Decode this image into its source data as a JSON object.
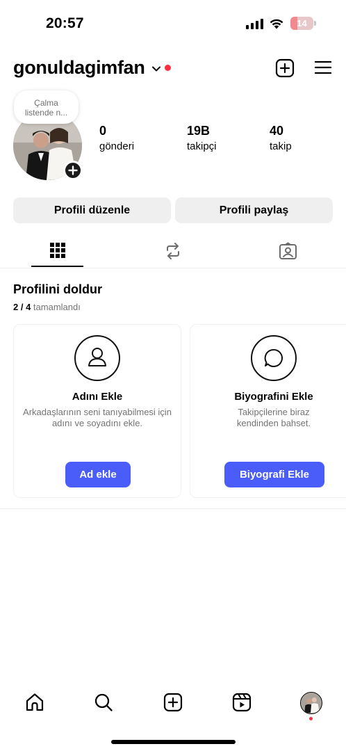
{
  "status_bar": {
    "time": "20:57",
    "battery": "14",
    "battery_level": 0.14,
    "icons": [
      "cellular-signal-icon",
      "wifi-icon",
      "battery-charging-icon"
    ]
  },
  "header": {
    "username": "gonuldagimfan",
    "icons": [
      "chevron-down-icon",
      "notification-dot",
      "create-post-icon",
      "menu-icon"
    ],
    "accent_red": "#ff2f40"
  },
  "profile": {
    "note_line1": "Çalma",
    "note_line2": "listende n...",
    "stats": [
      {
        "value": "0",
        "label": "gönderi"
      },
      {
        "value": "19B",
        "label": "takipçi"
      },
      {
        "value": "40",
        "label": "takip"
      }
    ]
  },
  "actions": {
    "edit_label": "Profili düzenle",
    "share_label": "Profili paylaş"
  },
  "tabs": [
    {
      "icon": "grid-icon",
      "active": true
    },
    {
      "icon": "reposts-icon",
      "active": false
    },
    {
      "icon": "tagged-icon",
      "active": false
    }
  ],
  "complete_profile": {
    "title": "Profilini doldur",
    "progress_done": "2 / 4",
    "progress_text": "tamamlandı",
    "cards": [
      {
        "icon": "person-icon",
        "title": "Adını Ekle",
        "description": "Arkadaşlarının seni tanıyabilmesi için adını ve soyadını ekle.",
        "button": "Ad ekle"
      },
      {
        "icon": "speech-bubble-icon",
        "title": "Biyografini Ekle",
        "description": "Takipçilerine biraz kendinden bahset.",
        "button": "Biyografi Ekle"
      }
    ],
    "button_color": "#4a5df9"
  },
  "bottom_nav": {
    "items": [
      "home-icon",
      "search-icon",
      "create-icon",
      "reels-icon",
      "profile-avatar"
    ]
  }
}
